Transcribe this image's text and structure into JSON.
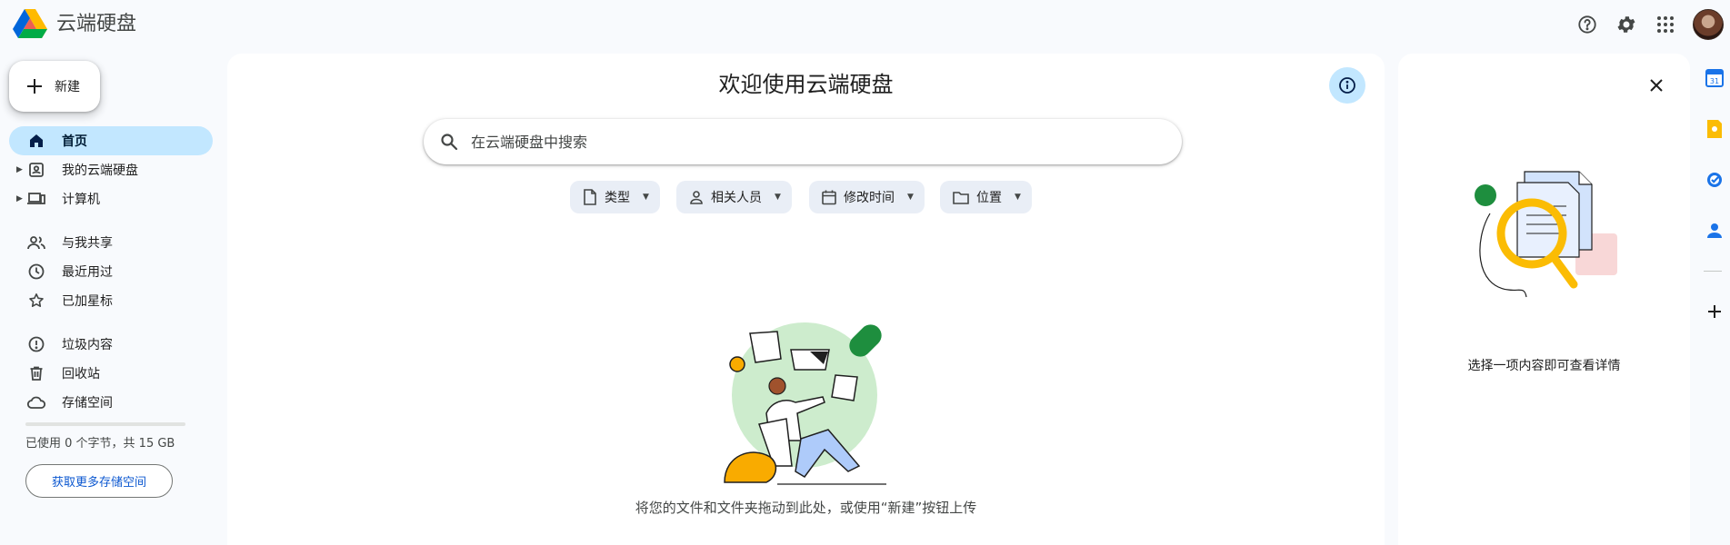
{
  "header": {
    "app_title": "云端硬盘",
    "icons": [
      "help-icon",
      "settings-icon",
      "apps-grid-icon"
    ]
  },
  "sidebar": {
    "new_label": "新建",
    "items": [
      {
        "label": "首页",
        "icon": "home-icon",
        "active": true
      },
      {
        "label": "我的云端硬盘",
        "icon": "my-drive-icon"
      },
      {
        "label": "计算机",
        "icon": "computer-icon"
      },
      {
        "label": "与我共享",
        "icon": "people-icon"
      },
      {
        "label": "最近用过",
        "icon": "clock-icon"
      },
      {
        "label": "已加星标",
        "icon": "star-icon"
      },
      {
        "label": "垃圾内容",
        "icon": "spam-icon"
      },
      {
        "label": "回收站",
        "icon": "trash-icon"
      },
      {
        "label": "存储空间",
        "icon": "cloud-icon"
      }
    ],
    "storage_usage": 0.0,
    "storage_text": "已使用 0 个字节，共 15 GB",
    "get_storage_label": "获取更多存储空间"
  },
  "main": {
    "welcome_title": "欢迎使用云端硬盘",
    "search_placeholder": "在云端硬盘中搜索",
    "filters": [
      {
        "label": "类型",
        "icon": "file-icon"
      },
      {
        "label": "相关人员",
        "icon": "person-icon"
      },
      {
        "label": "修改时间",
        "icon": "calendar-icon"
      },
      {
        "label": "位置",
        "icon": "folder-icon"
      }
    ],
    "empty_text": "将您的文件和文件夹拖动到此处，或使用“新建”按钮上传"
  },
  "details": {
    "hint_text": "选择一项内容即可查看详情"
  },
  "side_apps": [
    {
      "name": "calendar-app-icon",
      "text": "31",
      "color": "#1a73e8"
    },
    {
      "name": "keep-app-icon",
      "color": "#fbbc04"
    },
    {
      "name": "tasks-app-icon",
      "color": "#1a73e8"
    },
    {
      "name": "contacts-app-icon",
      "color": "#1a73e8"
    }
  ],
  "colors": {
    "accent": "#0b57d0",
    "active_nav": "#c2e7ff",
    "chip_bg": "#e9eef6",
    "page_bg": "#f8fafd"
  }
}
